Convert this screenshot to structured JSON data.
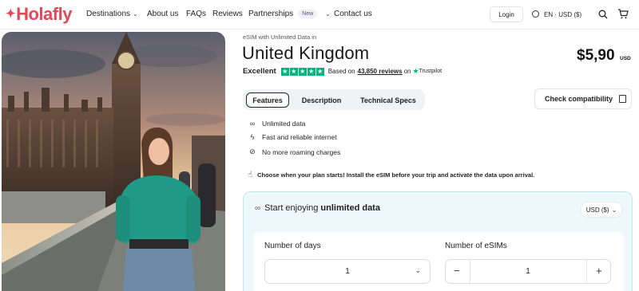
{
  "nav": {
    "logo": "Holafly",
    "links": {
      "destinations": "Destinations",
      "about": "About us",
      "faqs": "FAQs",
      "reviews": "Reviews",
      "partnerships": "Partnerships",
      "new_badge": "New",
      "contact": "Contact us"
    },
    "login": "Login",
    "language": "EN · USD ($)"
  },
  "product": {
    "eyebrow": "eSIM with Unlimited Data in",
    "title": "United Kingdom",
    "price": "$5,90",
    "currency": "USD",
    "rating": {
      "label": "Excellent",
      "based_on": "Based on",
      "reviews": "43,850 reviews",
      "on": "on",
      "platform": "Trustpilot",
      "stars": 5
    },
    "tabs": [
      "Features",
      "Description",
      "Technical Specs"
    ],
    "active_tab": "Features",
    "check_compat": "Check compatibility",
    "features": [
      {
        "icon": "infinity-icon",
        "text": "Unlimited data"
      },
      {
        "icon": "lightning-icon",
        "text": "Fast and reliable internet"
      },
      {
        "icon": "no-roaming-icon",
        "text": "No more roaming charges"
      }
    ],
    "plan_note": "Choose when your plan starts! Install the eSIM before your trip and activate the data upon arrival."
  },
  "plan": {
    "heading_prefix": "Start enjoying",
    "heading_bold": "unlimited data",
    "currency_select": "USD ($)",
    "days_label": "Number of days",
    "days_value": "1",
    "esims_label": "Number of eSIMs",
    "esims_value": "1"
  }
}
